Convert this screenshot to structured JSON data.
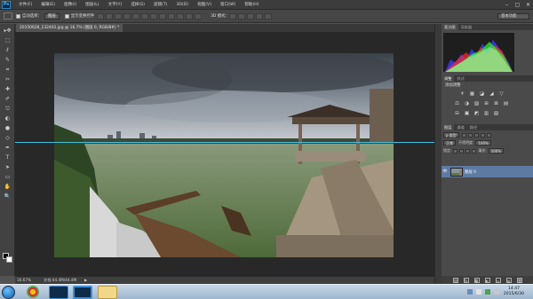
{
  "app": {
    "logo": "Ps",
    "menu": [
      "文件(F)",
      "编辑(E)",
      "图像(I)",
      "图层(L)",
      "文字(Y)",
      "选择(S)",
      "滤镜(T)",
      "3D(D)",
      "视图(V)",
      "窗口(W)",
      "帮助(H)"
    ],
    "window_controls": [
      "–",
      "▢",
      "✕"
    ]
  },
  "options_bar": {
    "auto_select_label": "自动选择：",
    "auto_select_value": "图层",
    "show_transform_label": "显示变换控件",
    "mode_3d_label": "3D 模式：",
    "workspace": "基本功能"
  },
  "document": {
    "tab_title": "20150628_132402.jpg @ 16.7% (图层 0, RGB/8#) *",
    "zoom": "16.67%",
    "doc_info": "文档:44.4M/44.4M",
    "status_arrow": "▶"
  },
  "tools": [
    "▸✥",
    "⬚",
    "ℓ",
    "✎",
    "⌗",
    "✂",
    "✚",
    "✐",
    "⎋",
    "◐",
    "●",
    "◇",
    "✒",
    "T",
    "➤",
    "▭",
    "✋",
    "🔍"
  ],
  "panels": {
    "histogram_tabs": [
      "直方图",
      "导航器"
    ],
    "adjust_tabs": [
      "调整",
      "样式"
    ],
    "adjust_title": "添加调整",
    "adjust_icons": [
      "☀",
      "▦",
      "◪",
      "◢",
      "▽",
      "⚖",
      "◑",
      "▨",
      "⊞",
      "⊠",
      "▤",
      "⊟",
      "▣",
      "◩",
      "▥",
      "▧"
    ],
    "layers_tabs": [
      "图层",
      "通道",
      "路径"
    ],
    "filter_kind": "ρ 类型",
    "blend_mode": "正常",
    "opacity_label": "不透明度:",
    "opacity_value": "100%",
    "lock_label": "锁定:",
    "fill_label": "填充:",
    "fill_value": "100%",
    "layer_name": "图层 0",
    "layer_eye": "👁",
    "footer_icons": [
      "⛓",
      "fx",
      "◘",
      "◐",
      "▭",
      "▤",
      "🗑"
    ]
  },
  "taskbar": {
    "time": "14:47",
    "date": "2015/6/30"
  },
  "colors": {
    "accent": "#5d7aa3",
    "guide": "#3fc0e0",
    "canvas_bg": "#282828"
  }
}
